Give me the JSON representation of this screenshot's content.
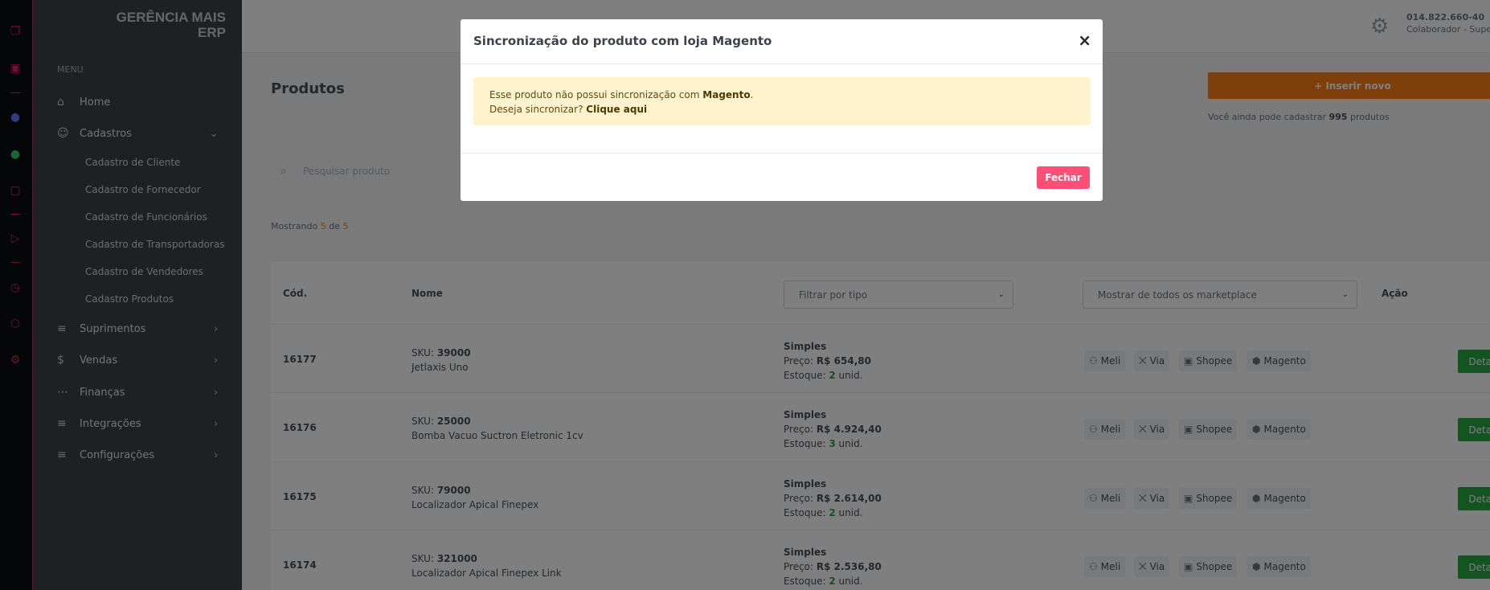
{
  "brand": {
    "line1": "GERÊNCIA MAIS",
    "line2": "ERP"
  },
  "sidebar": {
    "menu_title": "MENU",
    "items": [
      {
        "label": "Home"
      },
      {
        "label": "Cadastros"
      },
      {
        "label": "Suprimentos"
      },
      {
        "label": "Vendas"
      },
      {
        "label": "Finanças"
      },
      {
        "label": "Integrações"
      },
      {
        "label": "Configurações"
      }
    ],
    "subitems": [
      "Cadastro de Cliente",
      "Cadastro de Fornecedor",
      "Cadastro de Funcionários",
      "Cadastro de Transportadoras",
      "Cadastro de Vendedores",
      "Cadastro Produtos"
    ]
  },
  "topbar": {
    "phone": "014.822.660-40",
    "role": "Colaborador - Supe"
  },
  "page": {
    "title": "Produtos",
    "insert_label": "+ Inserir novo",
    "quota_prefix": "Você ainda pode cadastrar ",
    "quota_count": "995",
    "quota_suffix": " produtos",
    "search_placeholder": "Pesquisar produto",
    "showing_prefix": "Mostrando ",
    "showing_count": "5",
    "showing_mid": " de ",
    "showing_total": "5"
  },
  "table": {
    "col_code": "Cód.",
    "col_name": "Nome",
    "filter_type": "Filtrar por tipo",
    "filter_marketplace": "Mostrar de todos os marketplace",
    "col_action": "Ação",
    "sku_label": "SKU: ",
    "price_label": "Preço: ",
    "stock_label": "Estoque: ",
    "stock_unit": " unid.",
    "details_label": "Detalhes",
    "marketplaces": [
      "Meli",
      "Via",
      "Shopee",
      "Magento"
    ],
    "rows": [
      {
        "code": "16177",
        "sku": "39000",
        "name": "Jetlaxis Uno",
        "type": "Simples",
        "price": "R$ 654,80",
        "stock": "2"
      },
      {
        "code": "16176",
        "sku": "25000",
        "name": "Bomba Vacuo Suctron Eletronic 1cv",
        "type": "Simples",
        "price": "R$ 4.924,40",
        "stock": "3"
      },
      {
        "code": "16175",
        "sku": "79000",
        "name": "Localizador Apical Finepex",
        "type": "Simples",
        "price": "R$ 2.614,00",
        "stock": "2"
      },
      {
        "code": "16174",
        "sku": "321000",
        "name": "Localizador Apical Finepex Link",
        "type": "Simples",
        "price": "R$ 2.536,80",
        "stock": "2"
      }
    ]
  },
  "modal": {
    "title": "Sincronização do produto com loja Magento",
    "close_glyph": "×",
    "msg_prefix": "Esse produto não possui sincronização com ",
    "msg_store": "Magento",
    "msg_suffix": ".",
    "msg_question": "Deseja sincronizar? ",
    "msg_link": "Clique aqui",
    "close_button": "Fechar"
  },
  "colors": {
    "accent": "#e0245e",
    "orange": "#fd7e14",
    "success": "#28a745",
    "danger_button": "#ff4f77",
    "alert_bg": "#fff3cd"
  }
}
